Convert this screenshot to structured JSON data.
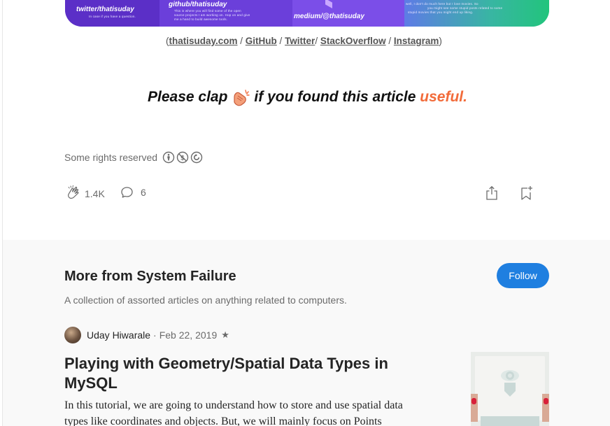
{
  "banner": {
    "twitter": "twitter/thatisuday",
    "twitter_sub": "In case if you have a question.",
    "github": "github/thatisuday",
    "github_sub1": "This is where you will find some of the open",
    "github_sub2": "source projects I am working on. Hop on and give",
    "github_sub3": "me a hand to build awesome tools.",
    "medium": "medium/@thatisuday",
    "movies_sub1": "well, I don't do much here but I love movies. So",
    "movies_sub2": "you might see some stupid posts related to some",
    "movies_sub3": "stupid movies that you might end up liking."
  },
  "links": {
    "open": "(",
    "close": ")",
    "sep1": " / ",
    "sep2": " / ",
    "sep3": "/ ",
    "sep4": " / ",
    "site": "thatisuday.com",
    "github": "GitHub",
    "twitter": "Twitter",
    "stackoverflow": "StackOverflow",
    "instagram": "Instagram"
  },
  "clap_line": {
    "before": "Please clap",
    "after": "if you found this article",
    "highlight": "useful.",
    "highlight_color": "#f26b3a"
  },
  "rights": {
    "text": "Some rights reserved",
    "icons": [
      "cc-by-icon",
      "cc-nc-icon",
      "cc-sa-icon"
    ]
  },
  "actions": {
    "claps": "1.4K",
    "responses": "6",
    "icons": [
      "clap-icon",
      "response-icon",
      "share-icon",
      "bookmark-add-icon"
    ]
  },
  "more_from": {
    "title": "More from System Failure",
    "description": "A collection of assorted articles on anything related to computers.",
    "follow_label": "Follow",
    "follow_color": "#1f7fe0"
  },
  "post": {
    "author": "Uday Hiwarale",
    "separator": "·",
    "date": "Feb 22, 2019",
    "star": "★",
    "title": "Playing with Geometry/Spatial Data Types in MySQL",
    "excerpt": "In this tutorial, we are going to understand how to store and use spatial data types like coordinates and objects. But, we will mainly focus on Points"
  }
}
